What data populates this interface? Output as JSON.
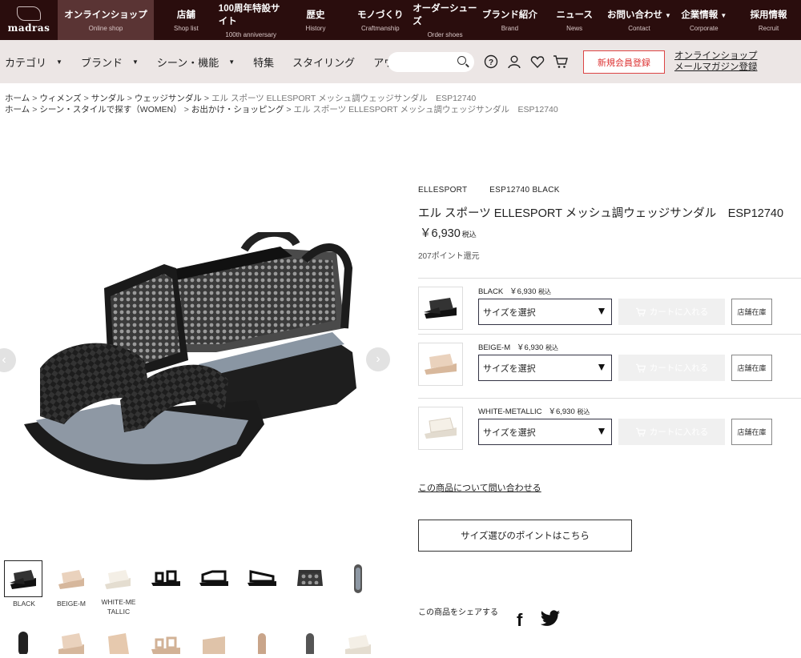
{
  "topnav": {
    "logo_text": "madras",
    "items": [
      {
        "jp": "オンラインショップ",
        "en": "Online shop",
        "caret": ""
      },
      {
        "jp": "店舗",
        "en": "Shop list",
        "caret": ""
      },
      {
        "jp": "100周年特設サイト",
        "en": "100th anniversary",
        "caret": ""
      },
      {
        "jp": "歴史",
        "en": "History",
        "caret": ""
      },
      {
        "jp": "モノづくり",
        "en": "Craftmanship",
        "caret": ""
      },
      {
        "jp": "オーダーシューズ",
        "en": "Order shoes",
        "caret": ""
      },
      {
        "jp": "ブランド紹介",
        "en": "Brand",
        "caret": ""
      },
      {
        "jp": "ニュース",
        "en": "News",
        "caret": ""
      },
      {
        "jp": "お問い合わせ",
        "en": "Contact",
        "caret": "▼"
      },
      {
        "jp": "企業情報",
        "en": "Corporate",
        "caret": "▼"
      },
      {
        "jp": "採用情報",
        "en": "Recruit",
        "caret": ""
      }
    ]
  },
  "subnav": {
    "categories": [
      {
        "label": "カテゴリ",
        "tri": "▼"
      },
      {
        "label": "ブランド",
        "tri": "▼"
      },
      {
        "label": "シーン・機能",
        "tri": "▼"
      },
      {
        "label": "特集",
        "tri": ""
      },
      {
        "label": "スタイリング",
        "tri": ""
      },
      {
        "label": "アウトレット",
        "tri": ""
      }
    ],
    "search_placeholder": "",
    "register_label": "新規会員登録",
    "magazine_line1": "オンラインショップ",
    "magazine_line2": "メールマガジン登録"
  },
  "breadcrumbs": {
    "line1": [
      "ホーム",
      "ウィメンズ",
      "サンダル",
      "ウェッジサンダル"
    ],
    "line1_current": "エル スポーツ ELLESPORT メッシュ調ウェッジサンダル　ESP12740",
    "line2": [
      "ホーム",
      "シーン・スタイルで探す（WOMEN）",
      "お出かけ・ショッピング"
    ],
    "line2_current": "エル スポーツ ELLESPORT メッシュ調ウェッジサンダル　ESP12740",
    "separator": ">"
  },
  "product": {
    "brand": "ELLESPORT",
    "code": "ESP12740 BLACK",
    "title": "エル スポーツ ELLESPORT メッシュ調ウェッジサンダル　ESP12740",
    "price": "￥6,930",
    "tax_label": "税込",
    "points": "207ポイント還元",
    "colors": {
      "black": "#1c1c1c",
      "beige": "#e8cdb5",
      "white": "#f2ece2",
      "sole": "#8e98a4"
    }
  },
  "thumbnails": {
    "labels": [
      "BLACK",
      "BEIGE-M",
      "WHITE-ME\nTALLIC"
    ],
    "label_black": "BLACK",
    "label_beige": "BEIGE-M",
    "label_white": "WHITE-ME TALLIC"
  },
  "variants": [
    {
      "name": "BLACK",
      "price": "￥6,930",
      "tax": "税込",
      "select": "サイズを選択",
      "cart": "カートに入れる",
      "stock": "店舗在庫"
    },
    {
      "name": "BEIGE-M",
      "price": "￥6,930",
      "tax": "税込",
      "select": "サイズを選択",
      "cart": "カートに入れる",
      "stock": "店舗在庫"
    },
    {
      "name": "WHITE-METALLIC",
      "price": "￥6,930",
      "tax": "税込",
      "select": "サイズを選択",
      "cart": "カートに入れる",
      "stock": "店舗在庫"
    }
  ],
  "inquiry_link": "この商品について問い合わせる",
  "size_guide_button": "サイズ選びのポイントはこちら",
  "share_label": "この商品をシェアする",
  "share_facebook": "f"
}
